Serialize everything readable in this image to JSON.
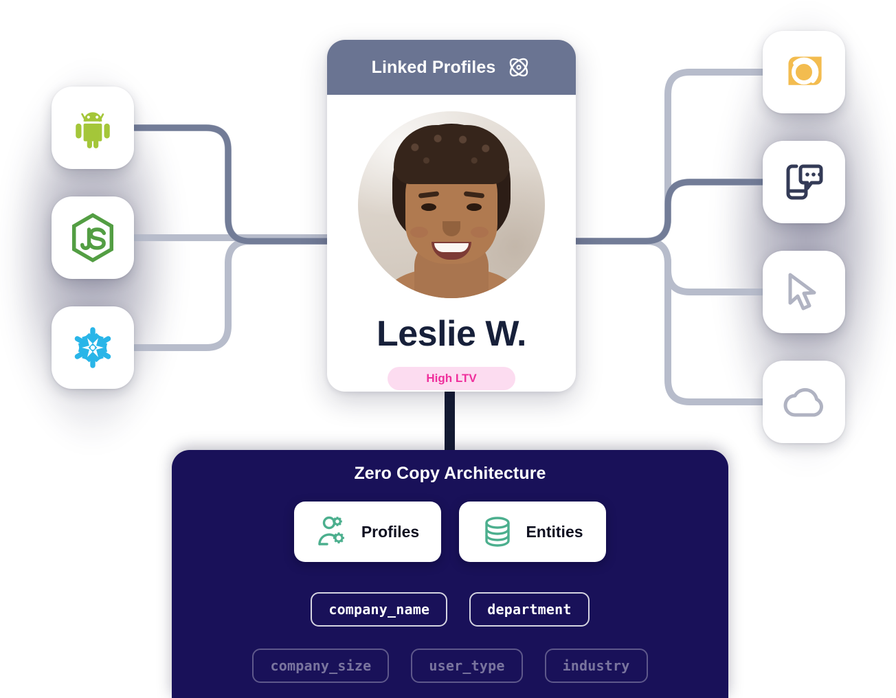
{
  "card": {
    "header_title": "Linked Profiles",
    "header_icon": "atom-icon",
    "avatar_alt": "profile-photo",
    "name": "Leslie W.",
    "badge": "High LTV"
  },
  "left_sources": [
    {
      "id": "android",
      "label": "Android",
      "icon": "android-icon",
      "color": "#A4C639"
    },
    {
      "id": "nodejs",
      "label": "Node.js",
      "icon": "nodejs-icon",
      "color": "#539E43"
    },
    {
      "id": "snowflake",
      "label": "Snowflake",
      "icon": "snowflake-icon",
      "color": "#29B5E8"
    }
  ],
  "right_destinations": [
    {
      "id": "amplitude",
      "label": "Analytics",
      "icon": "orange-square-circle-icon",
      "color": "#F3BC4F"
    },
    {
      "id": "sms",
      "label": "Mobile Messaging",
      "icon": "phone-chat-icon",
      "color": "#333A56"
    },
    {
      "id": "web",
      "label": "Web Pointer",
      "icon": "cursor-pointer-icon",
      "color": "#B0B3C2"
    },
    {
      "id": "cloud",
      "label": "Cloud",
      "icon": "cloud-icon",
      "color": "#B0B3C2"
    }
  ],
  "architecture": {
    "title": "Zero Copy Architecture",
    "cards": [
      {
        "label": "Profiles",
        "icon": "person-gear-icon"
      },
      {
        "label": "Entities",
        "icon": "database-icon"
      }
    ],
    "chips_active": [
      "company_name",
      "department"
    ],
    "chips_dim": [
      "company_size",
      "user_type",
      "industry"
    ]
  },
  "colors": {
    "header_bg": "#6A7492",
    "panel_bg": "#191159",
    "badge_bg": "#FCDCF0",
    "badge_text": "#EF2F9C",
    "wire_light": "#B7BCCB",
    "wire_dark": "#6E7893",
    "accent_green": "#4CAF8E"
  }
}
